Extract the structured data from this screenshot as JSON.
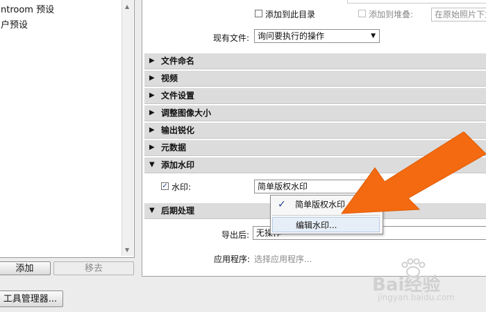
{
  "left_panel": {
    "presets": [
      "ntroom 预设",
      "户预设"
    ],
    "add_button": "添加",
    "remove_button": "移去"
  },
  "bottom": {
    "plugin_manager_button": "工具管理器..."
  },
  "top_options": {
    "add_to_catalog": "添加到此目录",
    "add_to_stack": "添加到堆叠:",
    "stack_position_value": "在原始照片下方"
  },
  "existing_files": {
    "label": "现有文件:",
    "value": "询问要执行的操作"
  },
  "sections": [
    {
      "label": "文件命名",
      "expanded": false
    },
    {
      "label": "视频",
      "expanded": false
    },
    {
      "label": "文件设置",
      "expanded": false
    },
    {
      "label": "调整图像大小",
      "expanded": false
    },
    {
      "label": "输出锐化",
      "expanded": false
    },
    {
      "label": "元数据",
      "expanded": false
    },
    {
      "label": "添加水印",
      "expanded": true
    },
    {
      "label": "后期处理",
      "expanded": true
    }
  ],
  "watermark": {
    "checkbox_label": "水印:",
    "checked": true,
    "select_value": "简单版权水印",
    "menu_items": [
      {
        "label": "简单版权水印",
        "checked": true
      },
      {
        "label": "编辑水印...",
        "checked": false
      }
    ]
  },
  "post_processing": {
    "after_export_label": "导出后:",
    "after_export_value": "无操作",
    "application_label": "应用程序:",
    "application_placeholder": "选择应用程序..."
  },
  "icons": {
    "collapsed": "triangle-right-icon",
    "expanded": "triangle-down-icon",
    "check": "check-icon"
  },
  "colors": {
    "annotation_arrow": "#f36a10",
    "section_bar": "#dcdcdc"
  },
  "watermark_overlay": {
    "text": "Bai经验",
    "subtext": "jingyan.baidu.com"
  }
}
